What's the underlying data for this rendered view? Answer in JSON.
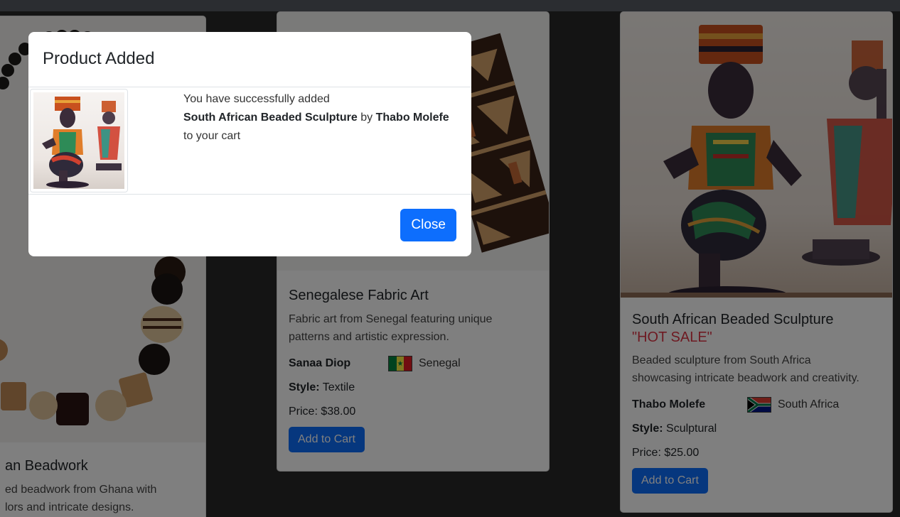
{
  "cards": [
    {
      "title": "an Beadwork",
      "description_lines": [
        "ed beadwork from Ghana with",
        "lors and intricate designs."
      ]
    },
    {
      "title": "Senegalese Fabric Art",
      "description_lines": [
        "Fabric art from Senegal featuring unique",
        "patterns and artistic expression."
      ],
      "artist": "Sanaa Diop",
      "country": "Senegal",
      "style_label": "Style:",
      "style": "Textile",
      "price": "Price: $38.00",
      "button": "Add to Cart"
    },
    {
      "title": "South African Beaded Sculpture",
      "badge": "\"HOT SALE\"",
      "description_lines": [
        "Beaded sculpture from South Africa",
        "showcasing intricate beadwork and creativity."
      ],
      "artist": "Thabo Molefe",
      "country": "South Africa",
      "style_label": "Style:",
      "style": "Sculptural",
      "price": "Price: $25.00",
      "button": "Add to Cart"
    }
  ],
  "modal": {
    "title": "Product Added",
    "line1": "You have successfully added",
    "product": "South African Beaded Sculpture",
    "by": "by",
    "artist": "Thabo Molefe",
    "line3": "to your cart",
    "close": "Close"
  },
  "colors": {
    "primary": "#0d6efd",
    "hot_sale": "#dc3545"
  }
}
